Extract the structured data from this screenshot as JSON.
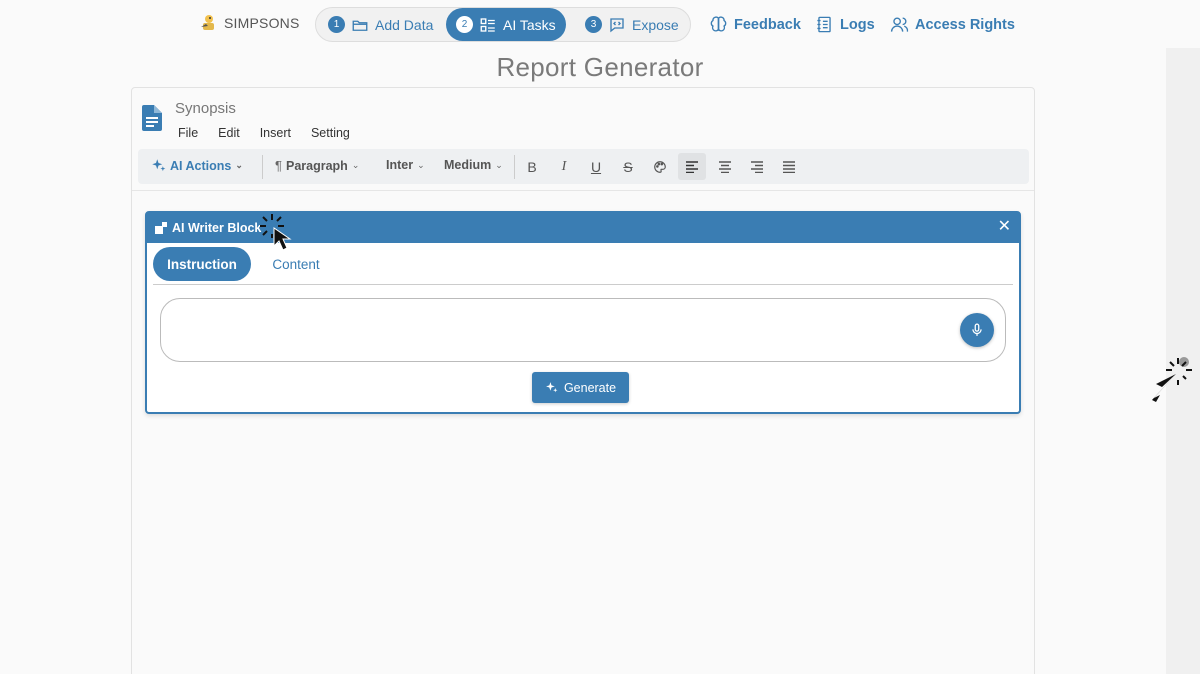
{
  "brand": {
    "name": "SIMPSONS"
  },
  "stepper": {
    "steps": [
      {
        "num": "1",
        "label": "Add Data",
        "icon": "folder-icon"
      },
      {
        "num": "2",
        "label": "AI Tasks",
        "icon": "tasks-icon"
      },
      {
        "num": "3",
        "label": "Expose",
        "icon": "code-message-icon"
      }
    ]
  },
  "nav": {
    "feedback": "Feedback",
    "logs": "Logs",
    "access": "Access Rights"
  },
  "page": {
    "title": "Report Generator"
  },
  "document": {
    "title": "Synopsis",
    "menu": [
      "File",
      "Edit",
      "Insert",
      "Setting"
    ]
  },
  "toolbar": {
    "ai_actions": "AI Actions",
    "paragraph": "Paragraph",
    "font": "Inter",
    "weight": "Medium"
  },
  "ai_block": {
    "title": "AI Writer Block",
    "tabs": [
      "Instruction",
      "Content"
    ],
    "active_tab": "Instruction",
    "input_value": "",
    "generate": "Generate"
  },
  "colors": {
    "accent": "#3a7db3"
  }
}
